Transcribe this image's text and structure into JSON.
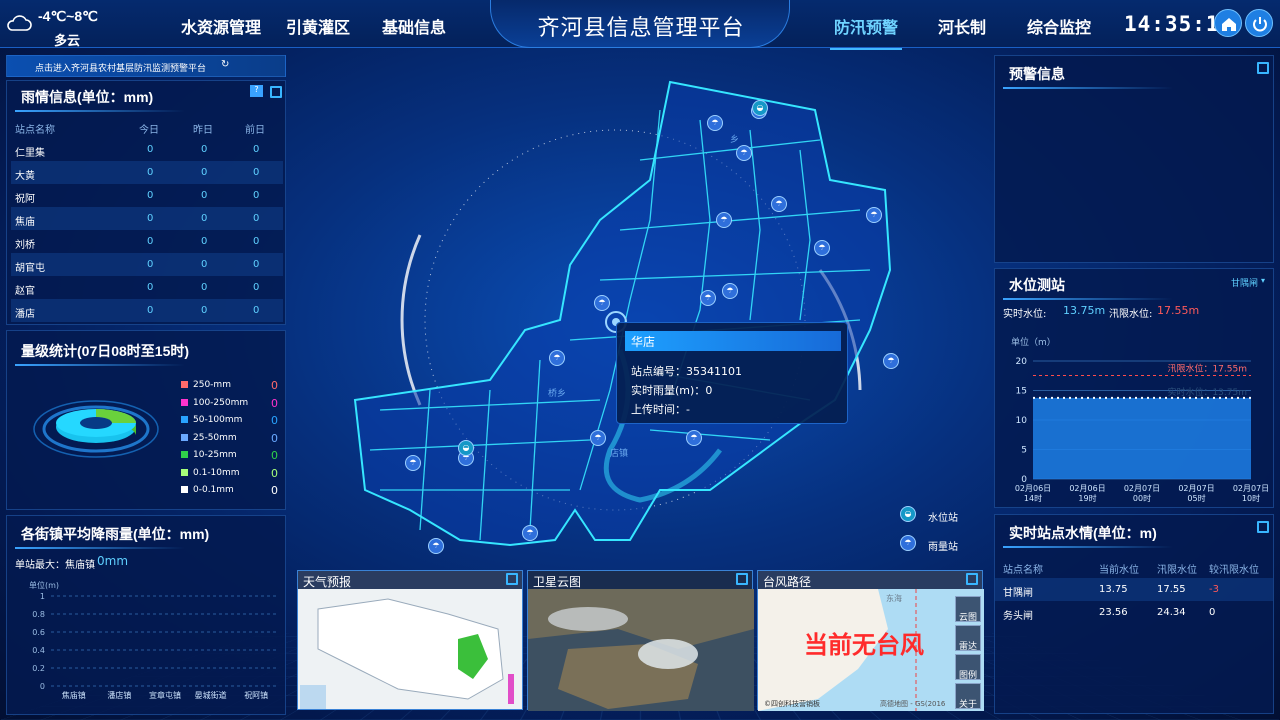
{
  "weather": {
    "temp": "-4℃~8℃",
    "desc": "多云",
    "icon": "cloud-icon"
  },
  "nav": {
    "left": [
      "水资源管理",
      "引黄灌区",
      "基础信息"
    ],
    "right": [
      "防汛预警",
      "河长制",
      "综合监控"
    ],
    "active": "防汛预警"
  },
  "title": "齐河县信息管理平台",
  "clock": "14:35:14",
  "link_banner": "点击进入齐河县农村基层防汛监测预警平台",
  "rain": {
    "title": "雨情信息(单位：mm)",
    "headers": [
      "站点名称",
      "今日",
      "昨日",
      "前日"
    ],
    "rows": [
      [
        "仁里集",
        "0",
        "0",
        "0"
      ],
      [
        "大黄",
        "0",
        "0",
        "0"
      ],
      [
        "祝阿",
        "0",
        "0",
        "0"
      ],
      [
        "焦庙",
        "0",
        "0",
        "0"
      ],
      [
        "刘桥",
        "0",
        "0",
        "0"
      ],
      [
        "胡官屯",
        "0",
        "0",
        "0"
      ],
      [
        "赵官",
        "0",
        "0",
        "0"
      ],
      [
        "潘店",
        "0",
        "0",
        "0"
      ]
    ]
  },
  "level": {
    "title": "量级统计(07日08时至15时)",
    "items": [
      {
        "label": "250-mm",
        "value": "0",
        "color": "#ff6b6b"
      },
      {
        "label": "100-250mm",
        "value": "0",
        "color": "#ff33cc"
      },
      {
        "label": "50-100mm",
        "value": "0",
        "color": "#29a3ff"
      },
      {
        "label": "25-50mm",
        "value": "0",
        "color": "#6aa9ff"
      },
      {
        "label": "10-25mm",
        "value": "0",
        "color": "#2fd04a"
      },
      {
        "label": "0.1-10mm",
        "value": "0",
        "color": "#a6ff7a"
      },
      {
        "label": "0-0.1mm",
        "value": "0",
        "color": "#ffffff"
      }
    ]
  },
  "town": {
    "title": "各街镇平均降雨量(单位：mm)",
    "max_label": "单站最大：焦庙镇",
    "max_value": "0mm",
    "unit": "单位(m)",
    "chart_data": {
      "type": "bar",
      "categories": [
        "焦庙镇",
        "潘店镇",
        "宣章屯镇",
        "晏城街道",
        "祝阿镇"
      ],
      "values": [
        0,
        0,
        0,
        0,
        0
      ],
      "ylim": [
        0,
        1
      ],
      "yticks": [
        "0",
        "0.2",
        "0.4",
        "0.6",
        "0.8",
        "1"
      ]
    }
  },
  "tooltip": {
    "name": "华店",
    "code_label": "站点编号：",
    "code": "35341101",
    "rain_label": "实时雨量(m)：",
    "rain": "0",
    "time_label": "上传时间：",
    "time": "-"
  },
  "map_legend": {
    "water": "水位站",
    "rain": "雨量站"
  },
  "map_labels": [
    "乡",
    "桥乡",
    "店镇"
  ],
  "thumbs": [
    {
      "title": "天气预报"
    },
    {
      "title": "卫星云图"
    },
    {
      "title": "台风路径",
      "overlay": "当前无台风",
      "sea": "东海",
      "credit": "©四创科技营销板",
      "credit2": "高德地图 - GS(2016"
    }
  ],
  "map_buttons": [
    "云图",
    "雷达",
    "图例",
    "关于"
  ],
  "warning": {
    "title": "预警信息"
  },
  "waterlevel": {
    "title": "水位测站",
    "selector": "甘隅闸",
    "realtime_label": "实时水位:",
    "realtime": "13.75m",
    "flood_label": "汛限水位:",
    "flood": "17.55m",
    "unit": "单位（m）",
    "chart_data": {
      "type": "area",
      "x": [
        "02月06日 14时",
        "02月06日 19时",
        "02月07日 00时",
        "02月07日 05时",
        "02月07日 10时"
      ],
      "series": [
        {
          "name": "实时水位",
          "values": [
            13.75,
            13.75,
            13.75,
            13.75,
            13.75
          ]
        }
      ],
      "flood_line": 17.55,
      "ylim": [
        0,
        20
      ],
      "yticks": [
        "0",
        "5",
        "10",
        "15",
        "20"
      ],
      "flood_text": "汛限水位：17.55m",
      "real_text": "实时水位：13.75m"
    }
  },
  "station": {
    "title": "实时站点水情(单位：m)",
    "headers": [
      "站点名称",
      "当前水位",
      "汛限水位",
      "较汛限水位"
    ],
    "rows": [
      [
        "甘隅闸",
        "13.75",
        "17.55",
        "-3"
      ],
      [
        "务头闸",
        "23.56",
        "24.34",
        "0"
      ]
    ]
  }
}
